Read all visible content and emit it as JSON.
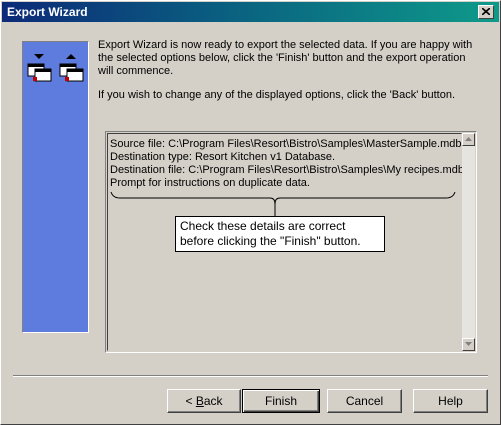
{
  "window": {
    "title": "Export Wizard"
  },
  "intro": {
    "para1": "Export Wizard is now ready to export the selected data.  If you are happy with the selected options below, click the 'Finish' button and the export operation will commence.",
    "para2": "If you wish to change any of the displayed options, click the 'Back' button."
  },
  "details": {
    "lines": [
      "Source file: C:\\Program Files\\Resort\\Bistro\\Samples\\MasterSample.mdb",
      "Destination type: Resort Kitchen v1 Database.",
      "Destination file: C:\\Program Files\\Resort\\Bistro\\Samples\\My recipes.mdb",
      "Prompt for instructions on duplicate data."
    ],
    "callout_line1": "Check these details are correct",
    "callout_line2": "before clicking the \"Finish\" button."
  },
  "buttons": {
    "back_prefix": "< ",
    "back_mnemonic": "B",
    "back_rest": "ack",
    "finish": "Finish",
    "cancel": "Cancel",
    "help": "Help"
  },
  "icons": {
    "close": "close-icon",
    "export_arrows": "export-wizard-icon",
    "scroll_up": "scroll-up-arrow-icon",
    "scroll_down": "scroll-down-arrow-icon"
  },
  "colors": {
    "side_panel": "#5e7cde",
    "title_start": "#0c2a78",
    "title_end": "#0e9a8a"
  }
}
